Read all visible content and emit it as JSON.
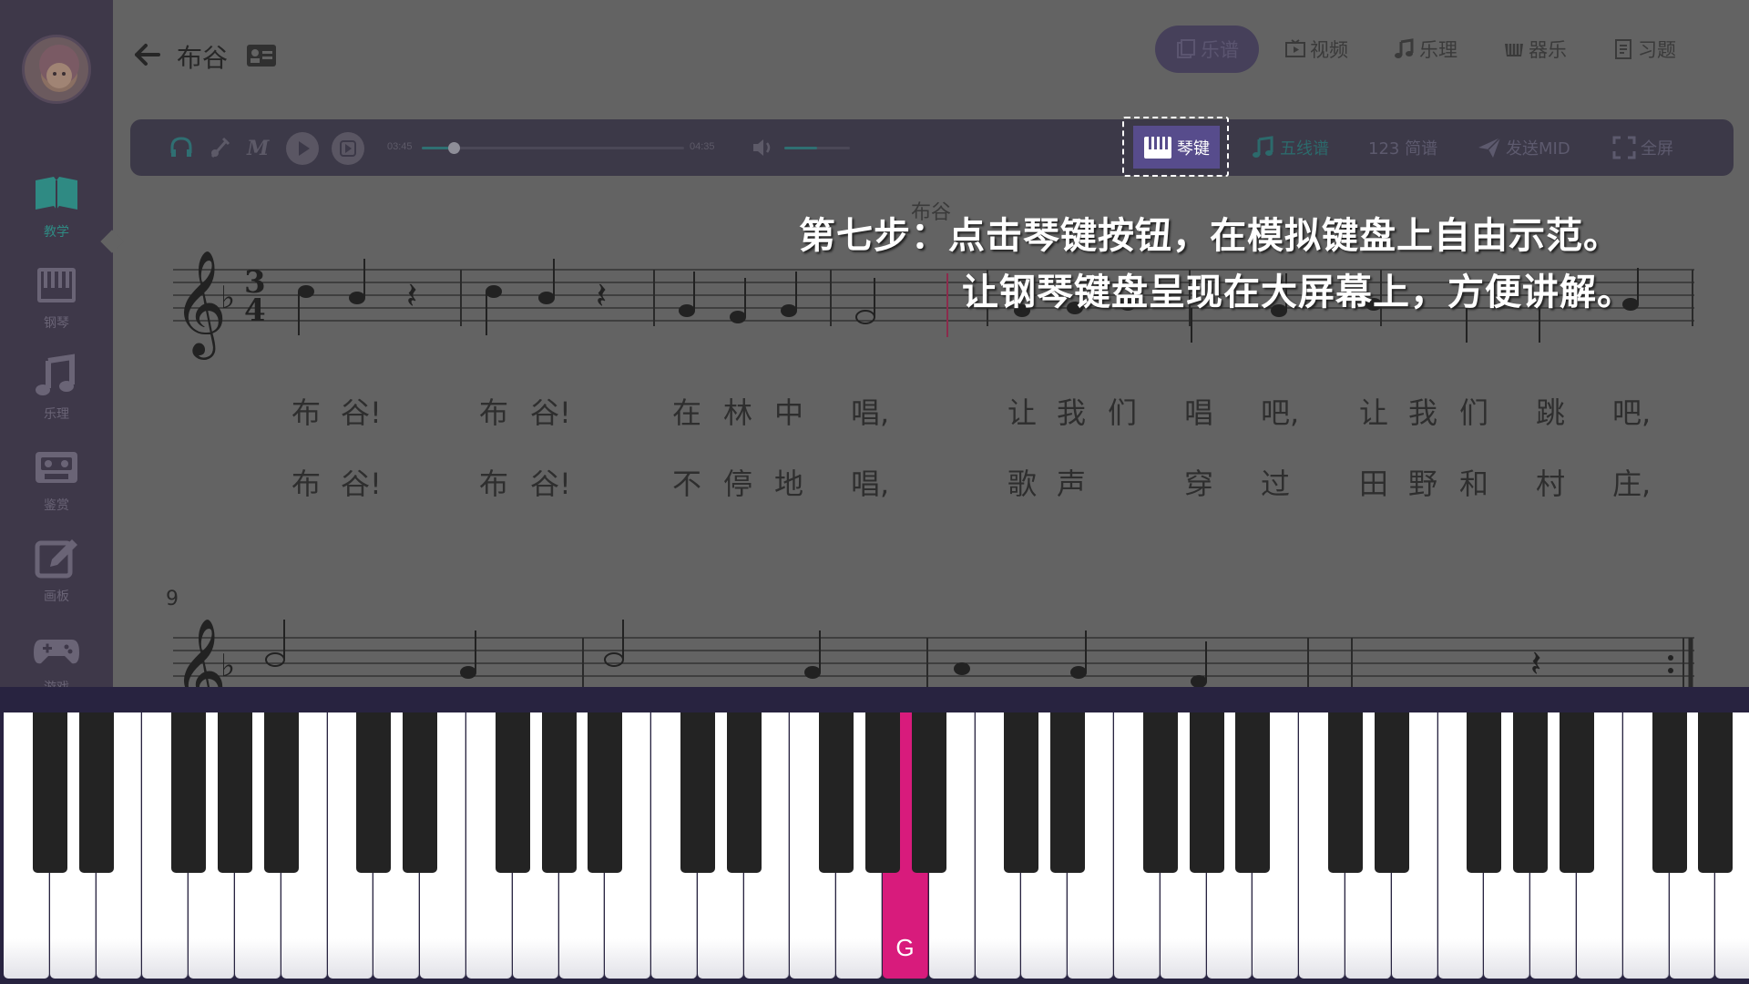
{
  "header": {
    "title": "布谷",
    "tabs": [
      {
        "label": "乐谱",
        "icon": "score-icon",
        "active": true
      },
      {
        "label": "视频",
        "icon": "video-icon",
        "active": false
      },
      {
        "label": "乐理",
        "icon": "music-note-icon",
        "active": false
      },
      {
        "label": "器乐",
        "icon": "instrument-icon",
        "active": false
      },
      {
        "label": "习题",
        "icon": "exercise-icon",
        "active": false
      }
    ]
  },
  "sidebar": {
    "items": [
      {
        "label": "教学",
        "icon": "book-icon",
        "active": true
      },
      {
        "label": "钢琴",
        "icon": "piano-icon",
        "active": false
      },
      {
        "label": "乐理",
        "icon": "music-note-icon",
        "active": false
      },
      {
        "label": "鉴赏",
        "icon": "cassette-icon",
        "active": false
      },
      {
        "label": "画板",
        "icon": "edit-icon",
        "active": false
      },
      {
        "label": "游戏",
        "icon": "gamepad-icon",
        "active": false
      }
    ]
  },
  "toolbar": {
    "current_time": "03:45",
    "total_time": "04:35",
    "progress": 0.12,
    "volume": 0.5,
    "piano_label": "琴键",
    "staff_label": "五线谱",
    "jianpu_label": "123 简谱",
    "send_midi_label": "发送MID",
    "fullscreen_label": "全屏"
  },
  "score": {
    "title": "布谷",
    "measure_number": "9",
    "lyrics_line1": [
      "布",
      "谷!",
      "布",
      "谷!",
      "在",
      "林",
      "中",
      "唱,",
      "让",
      "我",
      "们",
      "唱",
      "吧,",
      "让",
      "我",
      "们",
      "跳",
      "吧,"
    ],
    "lyrics_line2": [
      "布",
      "谷!",
      "布",
      "谷!",
      "不",
      "停",
      "地",
      "唱,",
      "歌",
      "声",
      "穿",
      "过",
      "田",
      "野",
      "和",
      "村",
      "庄,"
    ]
  },
  "instruction": {
    "line1": "第七步：点击琴键按钮，在模拟键盘上自由示范。",
    "line2": "让钢琴键盘呈现在大屏幕上，方便讲解。"
  },
  "piano": {
    "pressed_key_label": "G"
  },
  "colors": {
    "accent_purple": "#574c8c",
    "pressed_key": "#d81b7c",
    "teal": "#2f8a83"
  }
}
